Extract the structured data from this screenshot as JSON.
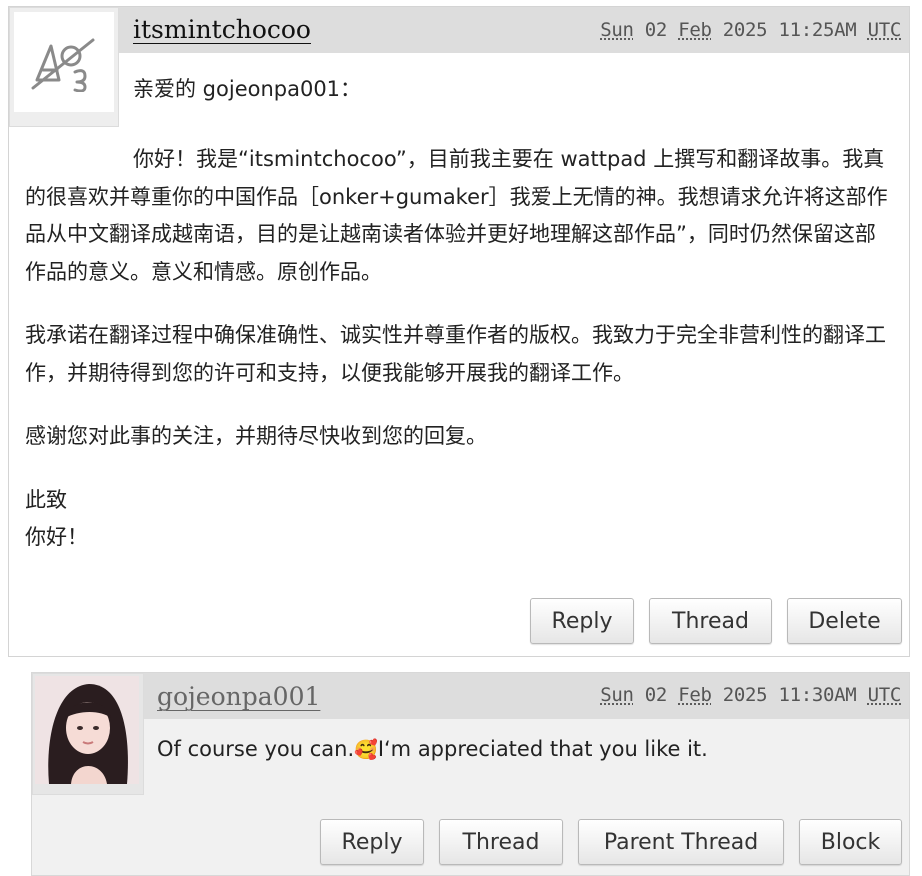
{
  "comments": [
    {
      "username": "itsmintchocoo",
      "datetime": {
        "day": "Sun",
        "date": "02",
        "month": "Feb",
        "year": "2025",
        "time": "11:25AM",
        "tz": "UTC"
      },
      "greeting": "亲爱的 gojeonpa001：",
      "paragraphs": [
        "你好！我是“itsmintchocoo”，目前我主要在 wattpad 上撰写和翻译故事。我真的很喜欢并尊重你的中国作品［onker+gumaker］我爱上无情的神。我想请求允许将这部作品从中文翻译成越南语，目的是让越南读者体验并更好地理解这部作品”，同时仍然保留这部作品的意义。意义和情感。原创作品。",
        "我承诺在翻译过程中确保准确性、诚实性并尊重作者的版权。我致力于完全非营利性的翻译工作，并期待得到您的许可和支持，以便我能够开展我的翻译工作。",
        "感谢您对此事的关注，并期待尽快收到您的回复。"
      ],
      "closing": [
        "此致",
        "你好！"
      ],
      "buttons": {
        "reply": "Reply",
        "thread": "Thread",
        "delete": "Delete"
      }
    },
    {
      "username": "gojeonpa001",
      "datetime": {
        "day": "Sun",
        "date": "02",
        "month": "Feb",
        "year": "2025",
        "time": "11:30AM",
        "tz": "UTC"
      },
      "text_before": "Of course you can.",
      "emoji": "🥰",
      "text_after": "I‘m appreciated that you like it.",
      "buttons": {
        "reply": "Reply",
        "thread": "Thread",
        "parent_thread": "Parent Thread",
        "block": "Block"
      }
    }
  ],
  "colors": {
    "header_bg": "#dddddd",
    "reply_bg": "#f1f1f1",
    "border": "#d4d4d4"
  }
}
